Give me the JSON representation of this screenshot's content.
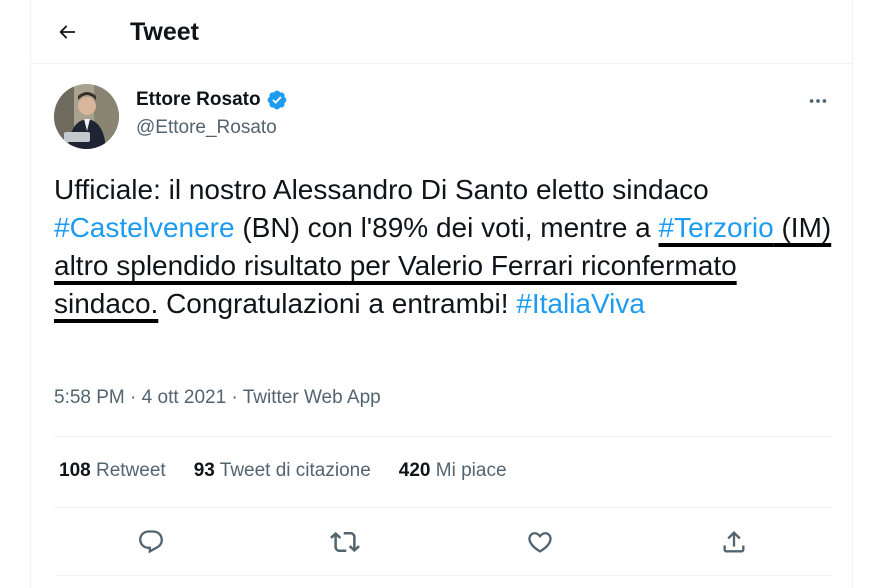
{
  "header": {
    "title": "Tweet",
    "back_icon": "arrow-left-icon"
  },
  "author": {
    "name": "Ettore Rosato",
    "handle": "@Ettore_Rosato",
    "verified_icon": "verified-badge-icon"
  },
  "tweet": {
    "text_1": "Ufficiale: il nostro Alessandro Di Santo eletto sindaco ",
    "hashtag_1": "#Castelvenere",
    "text_2": " (BN) con l'89% dei voti, mentre a ",
    "hashtag_2": "#Terzorio",
    "text_3": " (IM) altro splendido risultato per Valerio Ferrari riconfermato sindaco.",
    "text_4": " Congratulazioni a entrambi! ",
    "hashtag_3": "#ItaliaViva"
  },
  "meta": {
    "time": "5:58 PM",
    "sep1": " · ",
    "date": "4 ott 2021",
    "sep2": " · ",
    "source": "Twitter Web App"
  },
  "stats": {
    "retweets": {
      "count": "108",
      "label": "Retweet"
    },
    "quotes": {
      "count": "93",
      "label": "Tweet di citazione"
    },
    "likes": {
      "count": "420",
      "label": "Mi piace"
    }
  },
  "actions": [
    "reply-icon",
    "retweet-icon",
    "like-icon",
    "share-icon"
  ],
  "colors": {
    "accent": "#1d9bf0",
    "text": "#0f1419",
    "secondary": "#536471",
    "border": "#eff3f4"
  }
}
